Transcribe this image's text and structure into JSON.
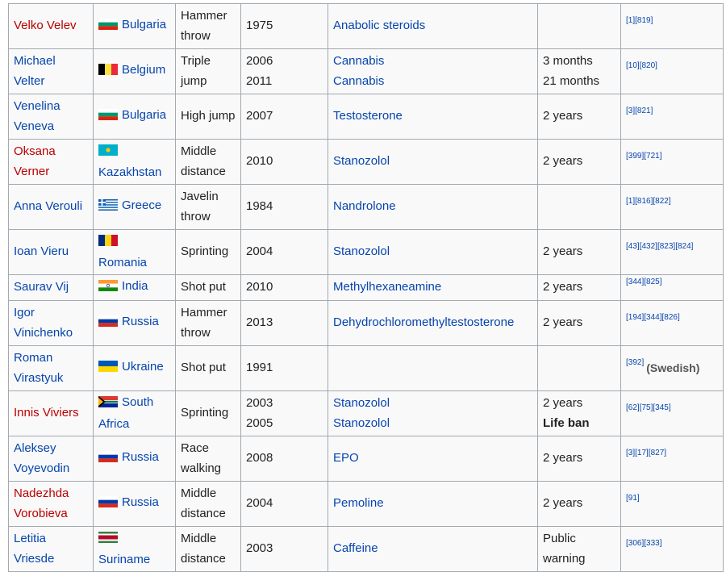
{
  "flag_colors": {
    "Bulgaria": [
      "#ffffff",
      "#00966e",
      "#d62612"
    ],
    "Belgium": [
      "#000000",
      "#fae042",
      "#ed2939"
    ],
    "Kazakhstan": [
      "#00afca"
    ],
    "Greece": [
      "#0d5eaf",
      "#ffffff"
    ],
    "Romania": [
      "#002b7f",
      "#fcd116",
      "#ce1126"
    ],
    "India": [
      "#ff9933",
      "#ffffff",
      "#138808"
    ],
    "Russia": [
      "#ffffff",
      "#0039a6",
      "#d52b1e"
    ],
    "Ukraine": [
      "#0057b7",
      "#ffd700"
    ],
    "South Africa": [
      "#de3831",
      "#007a4d",
      "#002395"
    ],
    "Suriname": [
      "#377e3f",
      "#ffffff",
      "#b40a2d"
    ]
  },
  "rows": [
    {
      "name": "Velko Velev",
      "name_new": true,
      "flag": "Bulgaria",
      "country": "Bulgaria",
      "event": "Hammer throw",
      "years": [
        "1975"
      ],
      "substances": [
        "Anabolic steroids"
      ],
      "sanctions": [],
      "refs": [
        "[1]",
        "[819]"
      ],
      "note": ""
    },
    {
      "name": "Michael Velter",
      "name_new": false,
      "flag": "Belgium",
      "country": "Belgium",
      "event": "Triple jump",
      "years": [
        "2006",
        "2011"
      ],
      "substances": [
        "Cannabis",
        "Cannabis"
      ],
      "sanctions": [
        "3 months",
        "21 months"
      ],
      "refs": [
        "[10]",
        "[820]"
      ],
      "note": ""
    },
    {
      "name": "Venelina Veneva",
      "name_new": false,
      "flag": "Bulgaria",
      "country": "Bulgaria",
      "event": "High jump",
      "years": [
        "2007"
      ],
      "substances": [
        "Testosterone"
      ],
      "sanctions": [
        "2 years"
      ],
      "refs": [
        "[3]",
        "[821]"
      ],
      "note": ""
    },
    {
      "name": "Oksana Verner",
      "name_new": true,
      "flag": "Kazakhstan",
      "country": "Kazakhstan",
      "event": "Middle distance",
      "years": [
        "2010"
      ],
      "substances": [
        "Stanozolol"
      ],
      "sanctions": [
        "2 years"
      ],
      "refs": [
        "[399]",
        "[721]"
      ],
      "note": ""
    },
    {
      "name": "Anna Verouli",
      "name_new": false,
      "flag": "Greece",
      "country": "Greece",
      "event": "Javelin throw",
      "years": [
        "1984"
      ],
      "substances": [
        "Nandrolone"
      ],
      "sanctions": [],
      "refs": [
        "[1]",
        "[816]",
        "[822]"
      ],
      "note": ""
    },
    {
      "name": "Ioan Vieru",
      "name_new": false,
      "flag": "Romania",
      "country": "Romania",
      "event": "Sprinting",
      "years": [
        "2004"
      ],
      "substances": [
        "Stanozolol"
      ],
      "sanctions": [
        "2 years"
      ],
      "refs": [
        "[43]",
        "[432]",
        "[823]",
        "[824]"
      ],
      "note": ""
    },
    {
      "name": "Saurav Vij",
      "name_new": false,
      "flag": "India",
      "country": "India",
      "event": "Shot put",
      "years": [
        "2010"
      ],
      "substances": [
        "Methylhexaneamine"
      ],
      "sanctions": [
        "2 years"
      ],
      "refs": [
        "[344]",
        "[825]"
      ],
      "note": ""
    },
    {
      "name": "Igor Vinichenko",
      "name_new": false,
      "flag": "Russia",
      "country": "Russia",
      "event": "Hammer throw",
      "years": [
        "2013"
      ],
      "substances": [
        "Dehydrochloromethyltestosterone"
      ],
      "sanctions": [
        "2 years"
      ],
      "refs": [
        "[194]",
        "[344]",
        "[826]"
      ],
      "note": ""
    },
    {
      "name": "Roman Virastyuk",
      "name_new": false,
      "flag": "Ukraine",
      "country": "Ukraine",
      "event": "Shot put",
      "years": [
        "1991"
      ],
      "substances": [],
      "sanctions": [],
      "refs": [
        "[392]"
      ],
      "note": "(Swedish)"
    },
    {
      "name": "Innis Viviers",
      "name_new": true,
      "flag": "South Africa",
      "country": "South Africa",
      "event": "Sprinting",
      "years": [
        "2003",
        "2005"
      ],
      "substances": [
        "Stanozolol",
        "Stanozolol"
      ],
      "sanctions": [
        "2 years",
        "Life ban"
      ],
      "refs": [
        "[62]",
        "[75]",
        "[345]"
      ],
      "note": ""
    },
    {
      "name": "Aleksey Voyevodin",
      "name_new": false,
      "flag": "Russia",
      "country": "Russia",
      "event": "Race walking",
      "years": [
        "2008"
      ],
      "substances": [
        "EPO"
      ],
      "sanctions": [
        "2 years"
      ],
      "refs": [
        "[3]",
        "[17]",
        "[827]"
      ],
      "note": ""
    },
    {
      "name": "Nadezhda Vorobieva",
      "name_new": true,
      "flag": "Russia",
      "country": "Russia",
      "event": "Middle distance",
      "years": [
        "2004"
      ],
      "substances": [
        "Pemoline"
      ],
      "sanctions": [
        "2 years"
      ],
      "refs": [
        "[91]"
      ],
      "note": ""
    },
    {
      "name": "Letitia Vriesde",
      "name_new": false,
      "flag": "Suriname",
      "country": "Suriname",
      "event": "Middle distance",
      "years": [
        "2003"
      ],
      "substances": [
        "Caffeine"
      ],
      "sanctions": [
        "Public warning"
      ],
      "refs": [
        "[306]",
        "[333]"
      ],
      "note": ""
    }
  ]
}
